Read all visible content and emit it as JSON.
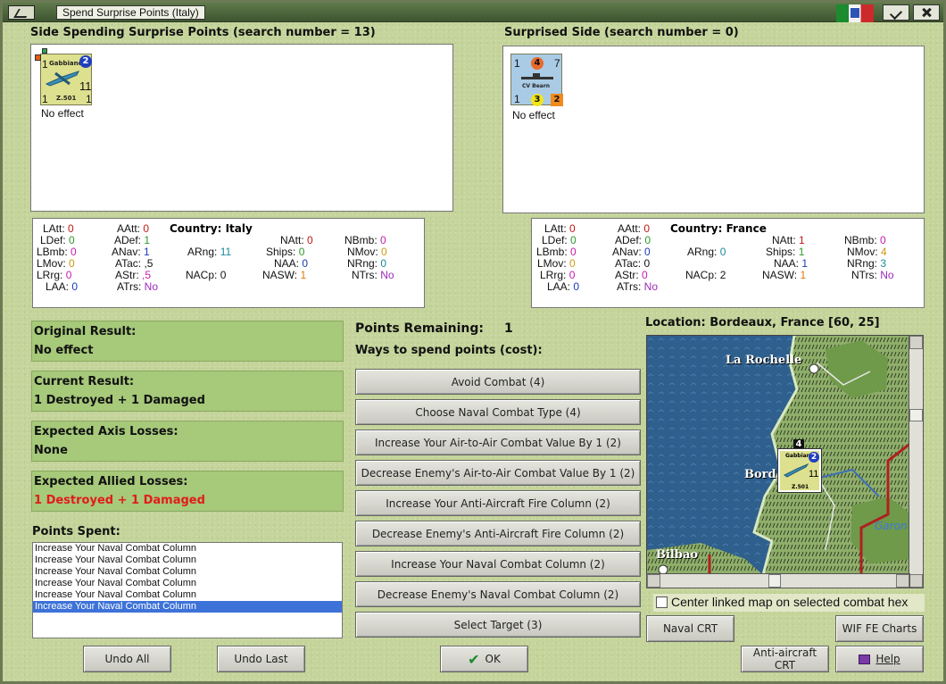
{
  "window": {
    "title": "Spend Surprise Points (Italy)"
  },
  "left_side": {
    "heading": "Side Spending Surprise Points (search number = 13)",
    "unit": {
      "name": "Gabbiano",
      "type": "Z.501",
      "circle_value": "2",
      "value_right": "11",
      "value_bl": "1",
      "value_br": "1",
      "value_tl": "1",
      "result": "No effect"
    },
    "stats": {
      "country_label": "Country: Italy",
      "LAtt": "0",
      "LDef": "0",
      "LBmb": "0",
      "LMov": "0",
      "LRrg": "0",
      "LAA": "0",
      "AAtt": "0",
      "ADef": "1",
      "ANav": "1",
      "ATac": ",5",
      "AStr": ",5",
      "ATrs": "No",
      "ARng": "11",
      "NACp": "0",
      "NAtt": "0",
      "Ships": "0",
      "NAA": "0",
      "NASW": "1",
      "NBmb": "0",
      "NMov": "0",
      "NRng": "0",
      "NTrs": "No"
    }
  },
  "right_side": {
    "heading": "Surprised Side (search number = 0)",
    "unit": {
      "name": "CV Bearn",
      "v_tl": "1",
      "v_circle": "4",
      "v_tr": "7",
      "v_bl": "1",
      "v_bc": "3",
      "v_br": "2",
      "result": "No effect"
    },
    "stats": {
      "country_label": "Country: France",
      "LAtt": "0",
      "LDef": "0",
      "LBmb": "0",
      "LMov": "0",
      "LRrg": "0",
      "LAA": "0",
      "AAtt": "0",
      "ADef": "0",
      "ANav": "0",
      "ATac": "0",
      "AStr": "0",
      "ATrs": "No",
      "ARng": "0",
      "NACp": "2",
      "NAtt": "1",
      "Ships": "1",
      "NAA": "1",
      "NASW": "1",
      "NBmb": "0",
      "NMov": "4",
      "NRng": "3",
      "NTrs": "No"
    }
  },
  "results": {
    "original_label": "Original Result:",
    "original_value": "No effect",
    "current_label": "Current Result:",
    "current_value": "1 Destroyed + 1 Damaged",
    "axis_label": "Expected Axis Losses:",
    "axis_value": "None",
    "allied_label": "Expected Allied Losses:",
    "allied_value": "1 Destroyed + 1 Damaged"
  },
  "points_spent": {
    "label": "Points Spent:",
    "items": [
      "Increase Your Naval Combat Column",
      "Increase Your Naval Combat Column",
      "Increase Your Naval Combat Column",
      "Increase Your Naval Combat Column",
      "Increase Your Naval Combat Column",
      "Increase Your Naval Combat Column"
    ]
  },
  "spending": {
    "remaining_label": "Points Remaining:",
    "remaining_value": "1",
    "ways_label": "Ways to spend points (cost):",
    "options": [
      "Avoid Combat (4)",
      "Choose Naval Combat Type (4)",
      "Increase Your Air-to-Air Combat Value By 1 (2)",
      "Decrease Enemy's Air-to-Air Combat Value By 1 (2)",
      "Increase Your Anti-Aircraft Fire Column (2)",
      "Decrease Enemy's Anti-Aircraft Fire Column (2)",
      "Increase Your Naval Combat Column (2)",
      "Decrease Enemy's Naval Combat Column (2)",
      "Select Target (3)"
    ]
  },
  "map": {
    "location": "Location: Bordeaux, France [60, 25]",
    "city1": "La Rochelle",
    "city2": "Bord",
    "city3": "Bilbao",
    "river": "Garon",
    "counter_name": "Gabbiano",
    "counter_type": "Z.501",
    "counter_circle": "2",
    "counter_value": "11",
    "stack_count": "4",
    "center_checkbox": "Center linked map on selected combat hex"
  },
  "buttons": {
    "naval_crt": "Naval CRT",
    "wif_charts": "WIF FE Charts",
    "aa_crt": "Anti-aircraft CRT",
    "help": "Help",
    "undo_all": "Undo All",
    "undo_last": "Undo Last",
    "ok": "OK"
  }
}
